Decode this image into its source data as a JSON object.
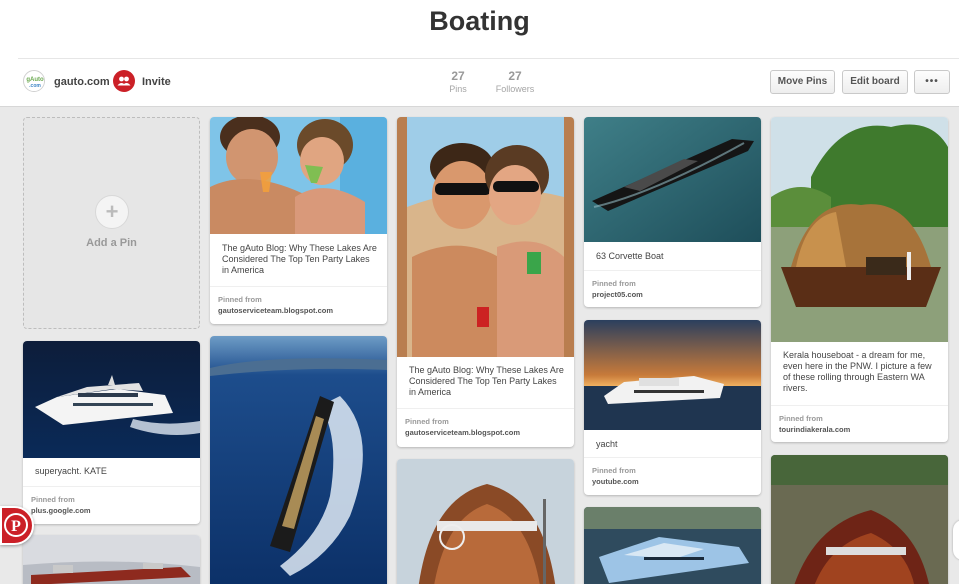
{
  "board": {
    "title": "Boating"
  },
  "owner": {
    "name": "gauto.com",
    "avatar_text": "gAuto.com"
  },
  "invite": {
    "label": "Invite",
    "icon": "people-plus-icon"
  },
  "stats": {
    "pins": {
      "count": "27",
      "label": "Pins"
    },
    "followers": {
      "count": "27",
      "label": "Followers"
    }
  },
  "toolbar": {
    "move_pins": "Move Pins",
    "edit_board": "Edit board",
    "more": "•••"
  },
  "add_pin": {
    "label": "Add a Pin",
    "plus": "+"
  },
  "source_label": "Pinned from",
  "pins": [
    {
      "description": "The gAuto Blog: Why These Lakes Are Considered The Top Ten Party Lakes in America",
      "source": "gautoserviceteam.blogspot.com"
    },
    {
      "description": "The gAuto Blog: Why These Lakes Are Considered The Top Ten Party Lakes in America",
      "source": "gautoserviceteam.blogspot.com"
    },
    {
      "description": "63 Corvette Boat",
      "source": "project05.com"
    },
    {
      "description": "Kerala houseboat - a dream for me, even here in the PNW. I picture a few of these rolling through Eastern WA rivers.",
      "source": "tourindiakerala.com"
    },
    {
      "description": "superyacht. KATE",
      "source": "plus.google.com"
    },
    {
      "description": "yacht",
      "source": "youtube.com"
    }
  ],
  "colors": {
    "brand": "#cb2027",
    "background": "#e9e9e9"
  }
}
